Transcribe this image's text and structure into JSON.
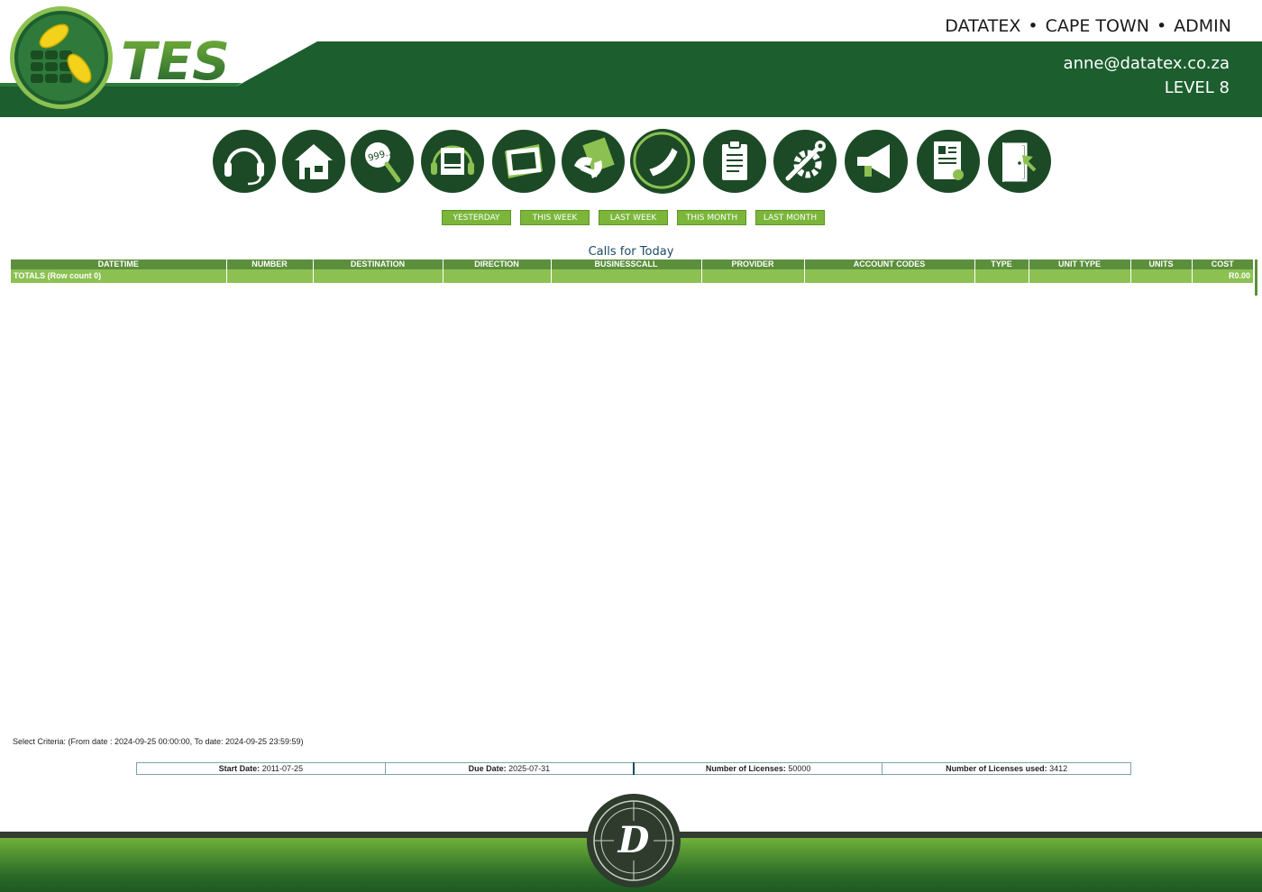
{
  "header": {
    "app_logo_text": "TES",
    "org": "DATATEX",
    "location": "CAPE TOWN",
    "role": "ADMIN",
    "separator": "•",
    "email": "anne@datatex.co.za",
    "level": "LEVEL 8"
  },
  "toolbar_icons": [
    "headset-icon",
    "home-icon",
    "number-search-icon",
    "operator-directory-icon",
    "screen-icon",
    "phone-bill-icon",
    "phone-call-icon",
    "clipboard-icon",
    "settings-icon",
    "announcement-icon",
    "certificate-icon",
    "logout-icon"
  ],
  "periods": {
    "yesterday": "YESTERDAY",
    "this_week": "THIS WEEK",
    "last_week": "LAST WEEK",
    "this_month": "THIS MONTH",
    "last_month": "LAST MONTH"
  },
  "report": {
    "title": "Calls for Today",
    "columns": {
      "datetime": "DATETIME",
      "number": "NUMBER",
      "destination": "DESTINATION",
      "direction": "DIRECTION",
      "businesscall": "BUSINESSCALL",
      "provider": "PROVIDER",
      "account_codes": "ACCOUNT CODES",
      "type": "TYPE",
      "unit_type": "UNIT TYPE",
      "units": "UNITS",
      "cost": "COST"
    },
    "totals_label": "TOTALS (Row count 0)",
    "totals_cost": "R0.00"
  },
  "criteria": "Select Criteria: (From date : 2024-09-25 00:00:00, To date: 2024-09-25 23:59:59)",
  "license": {
    "start_label": "Start Date:",
    "start_value": "2011-07-25",
    "due_label": "Due Date:",
    "due_value": "2025-07-31",
    "licenses_label": "Number of Licenses:",
    "licenses_value": "50000",
    "used_label": "Number of Licenses used:",
    "used_value": "3412"
  },
  "footer": {
    "logo_letter": "D"
  },
  "colors": {
    "dark_green": "#1c5e2e",
    "icon_green": "#1c4a26",
    "button_green": "#7bb63a",
    "header_cell": "#5b8f3c",
    "totals_row": "#8cc152"
  }
}
